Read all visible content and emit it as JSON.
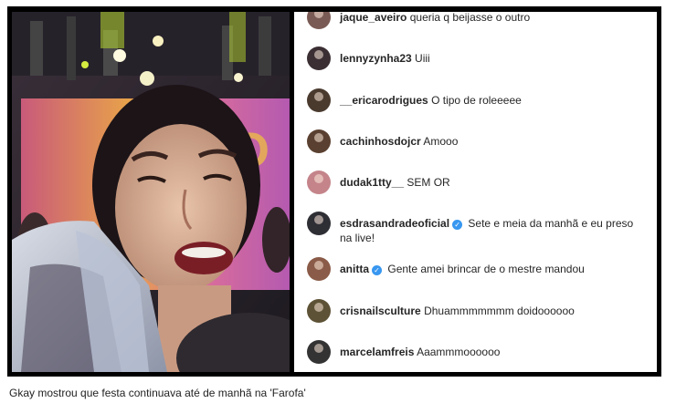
{
  "comments": [
    {
      "user": "jaque_aveiro",
      "text": "queria q beijasse o outro",
      "avatar_color": "#7a5a55",
      "verified": false
    },
    {
      "user": "lennyzynha23",
      "text": "Uiii",
      "avatar_color": "#3b2f34",
      "verified": false
    },
    {
      "user": "__ericarodrigues",
      "text": "O tipo de roleeeee",
      "avatar_color": "#4a3a2e",
      "verified": false
    },
    {
      "user": "cachinhosdojcr",
      "text": "Amooo",
      "avatar_color": "#5a4030",
      "verified": false
    },
    {
      "user": "dudak1tty__",
      "text": "SEM OR",
      "avatar_color": "#c4848a",
      "verified": false
    },
    {
      "user": "esdrasandradeoficial",
      "text": "Sete e meia da manhã e eu preso na live!",
      "avatar_color": "#2e2e35",
      "verified": true
    },
    {
      "user": "anitta",
      "text": "Gente amei brincar de o mestre mandou",
      "avatar_color": "#8a5b48",
      "verified": true
    },
    {
      "user": "crisnailsculture",
      "text": "Dhuammmmmmm doidoooooo",
      "avatar_color": "#5d5236",
      "verified": false
    },
    {
      "user": "marcelamfreis",
      "text": "Aaammmoooooo",
      "avatar_color": "#333333",
      "verified": false
    }
  ],
  "caption": "Gkay mostrou que festa continuava até de manhã na 'Farofa'",
  "colors": {
    "verified_badge": "#3897f0",
    "frame": "#000000"
  }
}
